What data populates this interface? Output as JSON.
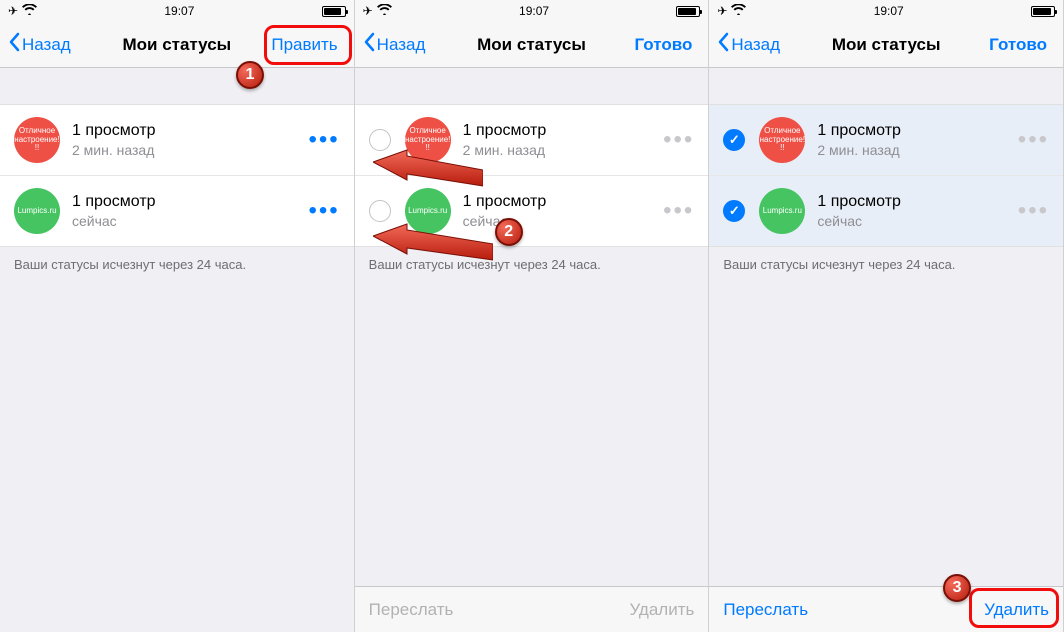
{
  "time": "19:07",
  "back_label": "Назад",
  "title": "Мои статусы",
  "actions": {
    "edit": "Править",
    "done": "Готово"
  },
  "statuses": [
    {
      "avatar_text": "Отличное настроение!!!",
      "avatar_color": "red",
      "title": "1 просмотр",
      "sub": "2 мин. назад"
    },
    {
      "avatar_text": "Lumpics.ru",
      "avatar_color": "green",
      "title": "1 просмотр",
      "sub": "сейчас"
    }
  ],
  "footer_note": "Ваши статусы исчезнут через 24 часа.",
  "toolbar": {
    "forward": "Переслать",
    "delete": "Удалить"
  },
  "badges": {
    "one": "1",
    "two": "2",
    "three": "3"
  }
}
